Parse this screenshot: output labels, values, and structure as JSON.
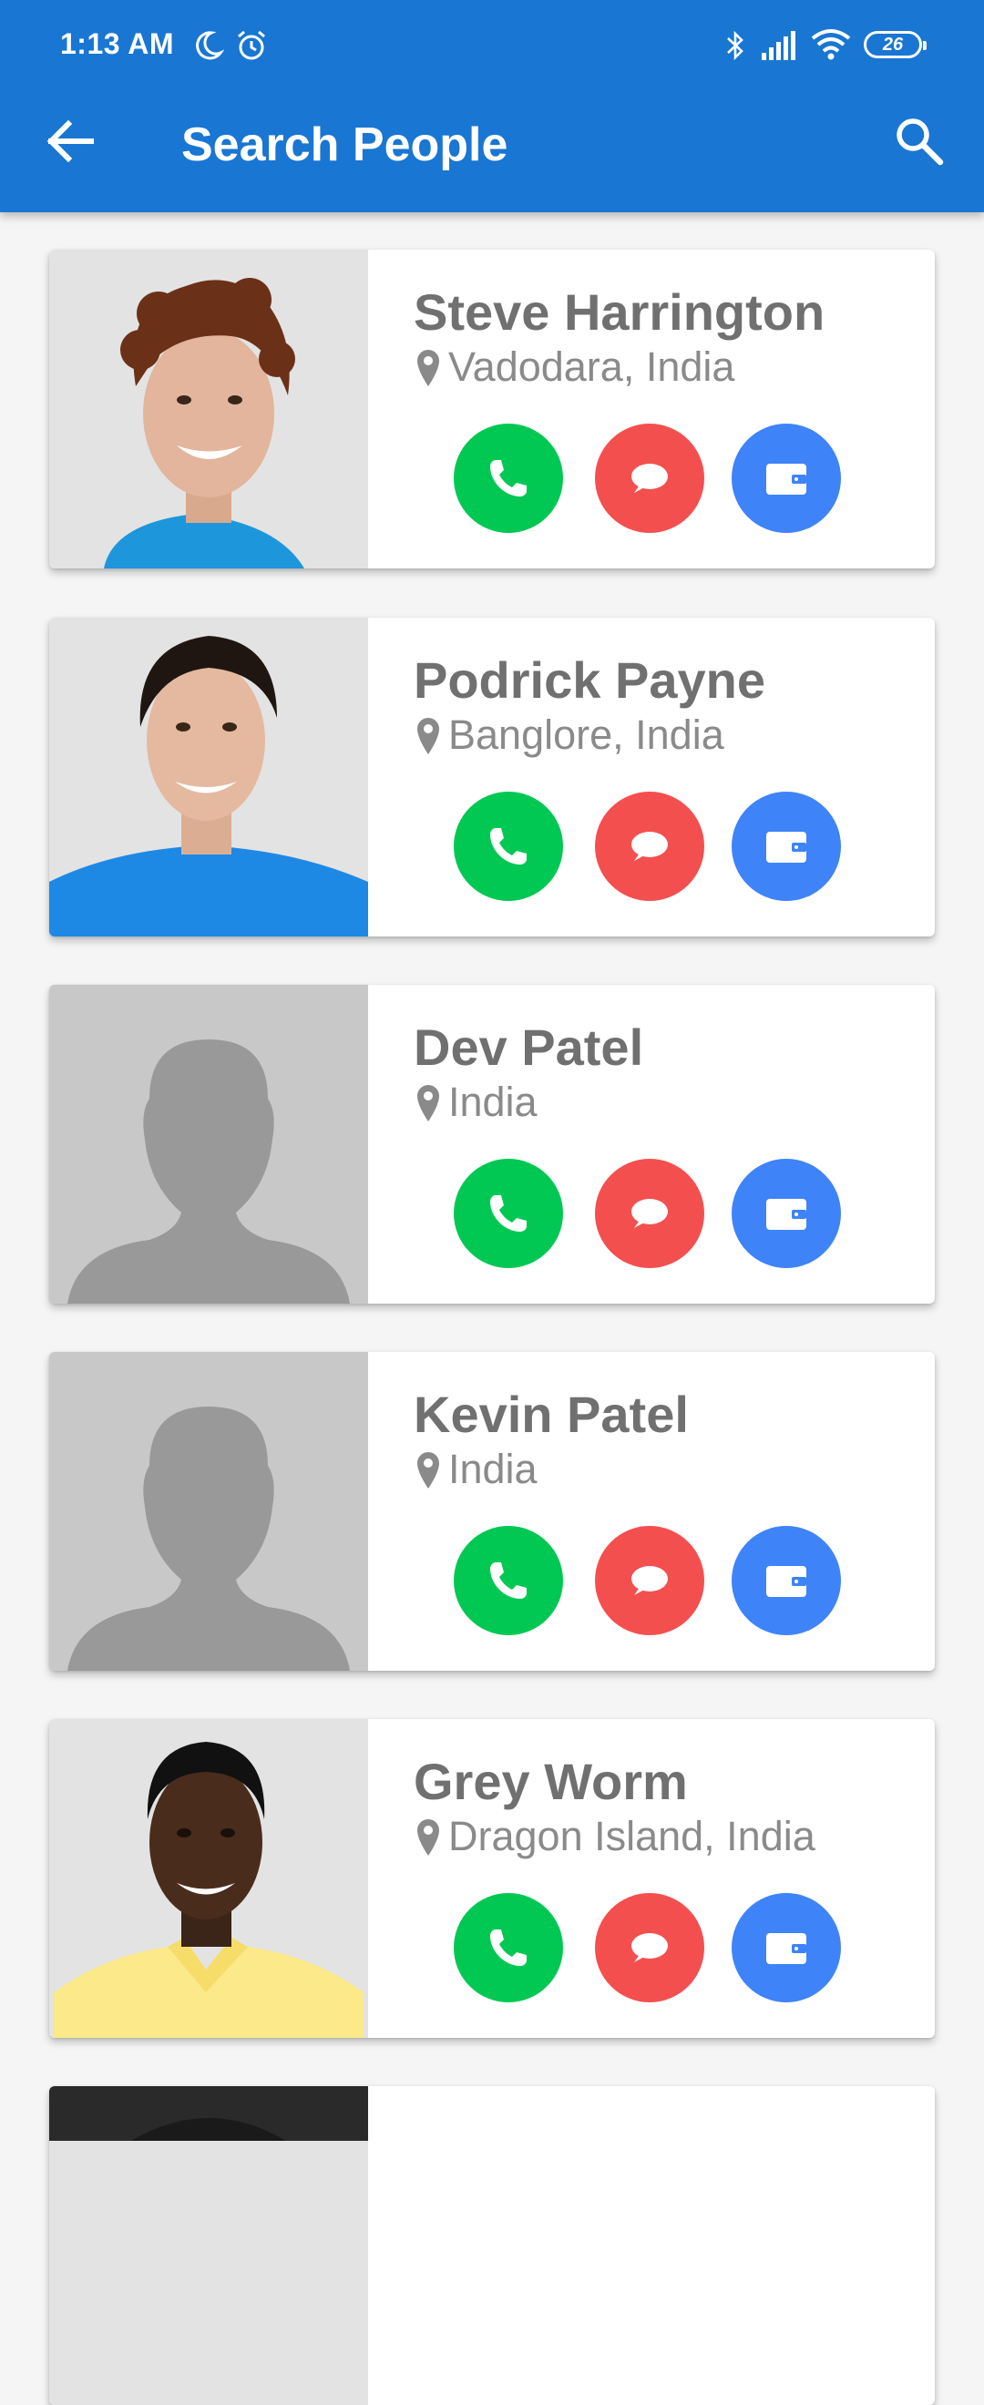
{
  "status_bar": {
    "time": "1:13 AM",
    "battery": "26",
    "icons": [
      "moon-icon",
      "alarm-icon",
      "bluetooth-icon",
      "signal-icon",
      "wifi-icon",
      "battery-icon"
    ]
  },
  "app_bar": {
    "title": "Search People",
    "back_icon": "arrow-left-icon",
    "search_icon": "search-icon"
  },
  "colors": {
    "app_bar": "#1976d2",
    "call": "#00c853",
    "message": "#f44f4f",
    "wallet": "#3f83f8",
    "name_text": "#707070",
    "location_text": "#8a8a8a"
  },
  "people": [
    {
      "name": "Steve Harrington",
      "location": "Vadodara, India",
      "photo": "curly-haired-man-photo"
    },
    {
      "name": "Podrick Payne",
      "location": "Banglore, India",
      "photo": "dark-haired-man-photo"
    },
    {
      "name": "Dev Patel",
      "location": "India",
      "photo": "default-avatar"
    },
    {
      "name": "Kevin Patel",
      "location": "India",
      "photo": "default-avatar"
    },
    {
      "name": "Grey Worm",
      "location": "Dragon Island, India",
      "photo": "man-yellow-shirt-photo"
    },
    {
      "name": "",
      "location": "",
      "photo": "partially-visible-photo"
    }
  ],
  "actions": [
    "call-icon",
    "message-icon",
    "wallet-icon"
  ]
}
